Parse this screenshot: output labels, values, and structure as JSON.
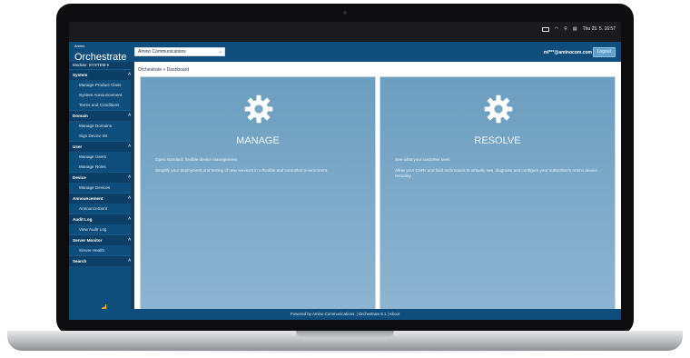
{
  "status_bar": {
    "time": "Thu 25. 5. 16:57",
    "icons": [
      "battery-icon",
      "wifi-icon",
      "search-icon",
      "control-center-icon"
    ]
  },
  "header": {
    "logo_small": "Amino",
    "logo_big": "Orchestrate",
    "org_select_value": "Amino Communications",
    "user_email": "ml***@aminocom.com",
    "logout_label": "Logout"
  },
  "sidebar": {
    "module_label": "Module: SYSTEM ▾",
    "sections": [
      {
        "title": "System",
        "items": [
          "Manage Product Class",
          "System Announcement",
          "Terms and Conditions"
        ]
      },
      {
        "title": "Domain",
        "items": [
          "Manage Domains",
          "Sign Device IM"
        ]
      },
      {
        "title": "User",
        "items": [
          "Manage Users",
          "Manage Roles"
        ]
      },
      {
        "title": "Device",
        "items": [
          "Manage Devices"
        ]
      },
      {
        "title": "Announcement",
        "items": [
          "Announcement"
        ]
      },
      {
        "title": "Audit Log",
        "items": [
          "View Audit Log"
        ]
      },
      {
        "title": "Server Monitor",
        "items": [
          "Server Health"
        ]
      },
      {
        "title": "Search",
        "items": []
      }
    ]
  },
  "breadcrumb": "Orchestrate » Dashboard",
  "panels": {
    "manage": {
      "title": "MANAGE",
      "line1": "Open standard, flexible device management",
      "line2": "Simplify your deployment and testing of new services in a flexible and controlled environment."
    },
    "resolve": {
      "title": "RESOLVE",
      "line1": "See what your customer sees",
      "line2": "Allow your CSRs and field technicians to virtually see, diagnose and configure your subscriber's Amino device remotely."
    }
  },
  "footer": "Powered by Amino Communications. | Orchestrate 8.1 | About"
}
